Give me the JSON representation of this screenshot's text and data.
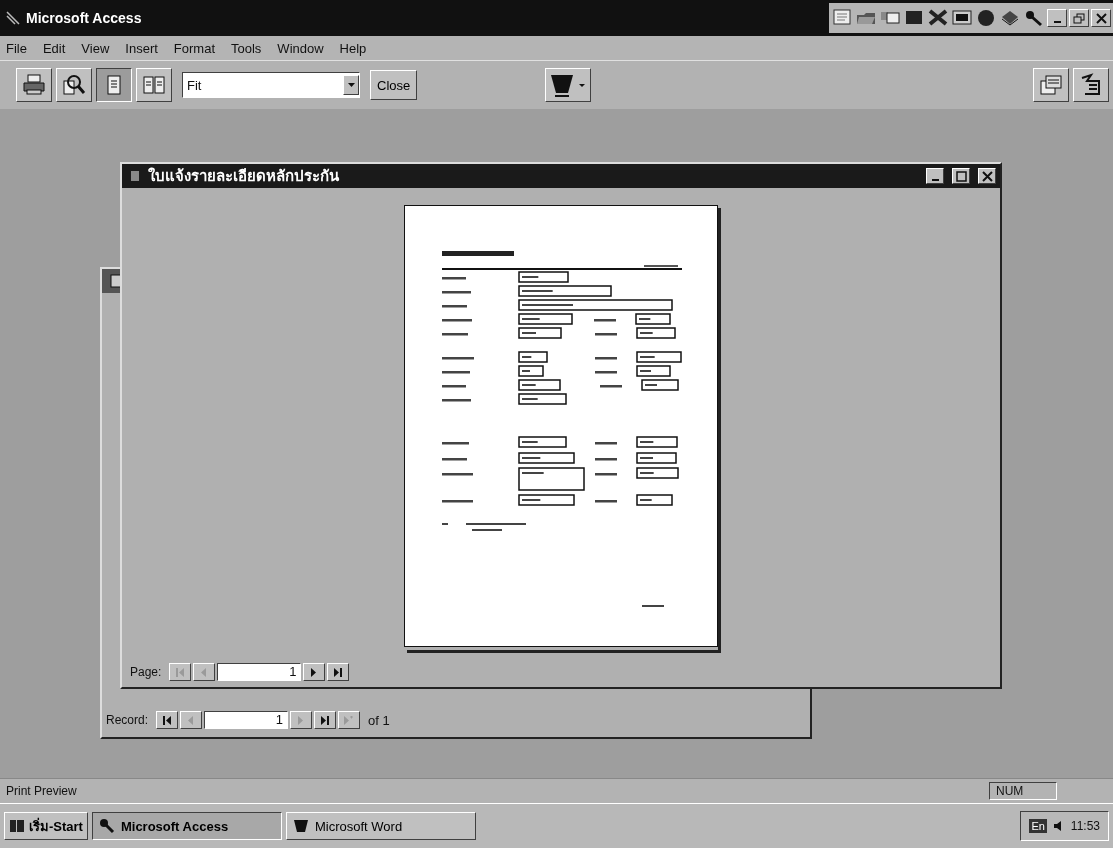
{
  "window": {
    "title": "Microsoft Access"
  },
  "menu": [
    "File",
    "Edit",
    "View",
    "Insert",
    "Format",
    "Tools",
    "Window",
    "Help"
  ],
  "toolbar": {
    "view_buttons": [
      {
        "kind": "one_page",
        "selected": true
      },
      {
        "kind": "two_pages",
        "selected": false
      }
    ],
    "zoom": {
      "value": "Fit"
    },
    "close_button": "Close"
  },
  "preview_window": {
    "title": "ใบแจ้งรายละเอียดหลักประกัน",
    "page_nav": {
      "label": "Page:",
      "value": "1",
      "buttons": [
        {
          "kind": "first",
          "disabled": true
        },
        {
          "kind": "prev",
          "disabled": true
        },
        {
          "kind": "next",
          "disabled": false
        },
        {
          "kind": "last",
          "disabled": false
        }
      ]
    }
  },
  "form_window": {
    "record_nav": {
      "label": "Record:",
      "value": "1",
      "total": "of 1",
      "buttons": [
        {
          "kind": "first",
          "disabled": false
        },
        {
          "kind": "prev",
          "disabled": true
        },
        {
          "kind": "next",
          "disabled": true
        },
        {
          "kind": "last",
          "disabled": false
        },
        {
          "kind": "new",
          "disabled": true
        }
      ]
    }
  },
  "status_bar": {
    "text": "Print Preview",
    "indicators": [
      "NUM"
    ]
  },
  "taskbar": {
    "start": "เริ่ม-Start",
    "tasks": [
      {
        "label": "Microsoft Access",
        "selected": true
      },
      {
        "label": "Microsoft Word",
        "selected": false
      }
    ],
    "tray": {
      "language": "En",
      "time": "11:53"
    }
  }
}
